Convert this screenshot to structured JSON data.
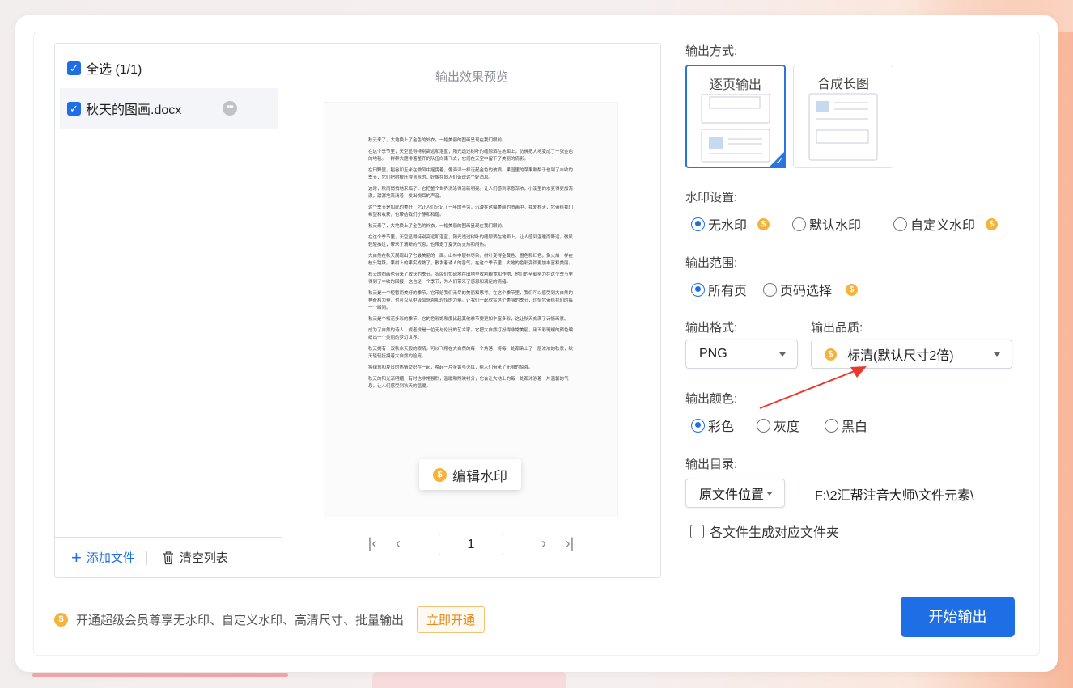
{
  "file_list": {
    "select_all_label": "全选 (1/1)",
    "files": [
      {
        "name": "秋天的图画.docx"
      }
    ],
    "add_file_label": "添加文件",
    "clear_list_label": "清空列表"
  },
  "preview": {
    "title": "输出效果预览",
    "page_paragraphs": [
      "秋天来了，大地换上了金色的外衣。一幅美丽的图画呈现在我们眼前。",
      "在这个季节里，天空显得特别高远和湛蓝，阳光透过树叶的缝隙洒在地面上，仿佛把大地变成了一张金色的地毯。一群群大雁排着整齐的队伍向南飞去，它们在天空中留下了美丽的倩影。",
      "在田野里，稻谷和玉米在微风中摇曳着，像海洋一样泛起金色的波浪。果园里的苹果和梨子也到了丰收的季节，它们把树枝压得弯弯的，好像在向人们诉说这个好消息。",
      "这时，秋雨悄悄地来临了，它把整个世界洗涤得清新明亮。让人们感到凉意渐浓，小溪里的水变得更加清澈，潺潺地流淌着，发出悦耳的声音。",
      "这个季节是如此的美好，它让人们忘记了一年的辛劳，沉浸在这幅美丽的图画中。我爱秋天，它带给我们希望和收获，也带给我们宁静和和谐。",
      "秋天来了，大地换上了金色的外衣。一幅美丽的图画呈现在我们眼前。",
      "在这个季节里，天空显得特别高远和湛蓝，阳光透过树叶的缝隙洒在地面上，让人感到温暖而舒适。微风轻轻拂过，带来了清新的气息，也带走了夏天的炎热和闷热。",
      "大自然在秋天展现出了它最美丽的一面。山林中层林尽染，树叶变得金黄色、橙色和红色，像火焰一样在枝头跳跃。果树上的果实成熟了，散发着诱人的香气。在这个季节里，大地的色彩变得更加丰富和美丽。",
      "秋天的图画也带来了收获的季节。农民们忙碌地在田地里收割粮食和作物，他们的辛勤努力在这个季节里得到了丰收的回报，这也是一个季节，为人们带来了感恩和满足的情绪。",
      "秋天是一个短暂而美好的季节，它带给我们无尽的美丽和思考。在这个季节里，我们可以感受到大自然的神奇和力量，也可以从中汲取感恩和珍惜的力量。让我们一起欣赏这个美丽的季节，珍惜它带给我们的每一个瞬间。",
      "秋天是个梅花多彩的季节，它的色彩饱和度比起其他季节要更加丰富多彩，这让秋天充满了诗情画意。",
      "成为了自然的诗人，或者说是一位无与伦比的艺术家。它把大自然打扮得非常美丽，用五彩斑斓的颜色编织出一个美丽的梦幻世界。",
      "秋天拥有一双秋水天般的眼睛，可以飞翔在大自然的每一个角落，将每一处都染上了一层浓浓的秋意，秋天轻轻抚摸着大自然的脸庞。",
      "将绿意和夏日的热情交织在一起，唤起一片金黄与火红，给人们带来了无限的惊喜。",
      "秋天的阳光渐明媚，有时也非常强烈，温暖和煦映衬分，它会让大地上的每一处都沐浴着一片温馨的气息，让人们感受到秋天的温暖。"
    ],
    "edit_watermark_label": "编辑水印",
    "current_page": "1"
  },
  "settings": {
    "output_mode_label": "输出方式:",
    "modes": [
      {
        "label": "逐页输出",
        "selected": true
      },
      {
        "label": "合成长图",
        "selected": false
      }
    ],
    "watermark_label": "水印设置:",
    "watermark_options": [
      {
        "label": "无水印",
        "selected": true,
        "vip": true
      },
      {
        "label": "默认水印",
        "selected": false,
        "vip": false
      },
      {
        "label": "自定义水印",
        "selected": false,
        "vip": true
      }
    ],
    "range_label": "输出范围:",
    "range_options": [
      {
        "label": "所有页",
        "selected": true,
        "vip": false
      },
      {
        "label": "页码选择",
        "selected": false,
        "vip": true
      }
    ],
    "format_label": "输出格式:",
    "format_value": "PNG",
    "quality_label": "输出品质:",
    "quality_value": "标清(默认尺寸2倍)",
    "color_label": "输出颜色:",
    "color_options": [
      {
        "label": "彩色",
        "selected": true
      },
      {
        "label": "灰度",
        "selected": false
      },
      {
        "label": "黑白",
        "selected": false
      }
    ],
    "dir_label": "输出目录:",
    "dir_select_value": "原文件位置",
    "dir_path": "F:\\2汇帮注音大师\\文件元素\\",
    "folder_option_label": "各文件生成对应文件夹"
  },
  "footer": {
    "promo_text": "开通超级会员尊享无水印、自定义水印、高清尺寸、批量输出",
    "open_now_label": "立即开通",
    "start_label": "开始输出"
  },
  "colors": {
    "accent": "#1e6fe6",
    "vip_coin": "#f5b33c",
    "arrow": "#e8392b"
  }
}
